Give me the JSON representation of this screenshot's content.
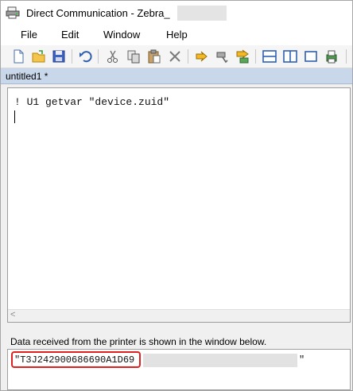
{
  "window": {
    "title": "Direct Communication - Zebra_"
  },
  "menu": {
    "items": [
      "File",
      "Edit",
      "Window",
      "Help"
    ]
  },
  "toolbar": {
    "icons": [
      "new-file-icon",
      "open-folder-icon",
      "save-icon",
      "undo-icon",
      "cut-icon",
      "copy-icon",
      "paste-icon",
      "delete-icon",
      "send-icon",
      "receive-icon",
      "send-file-icon",
      "split-horizontal-icon",
      "split-vertical-icon",
      "single-pane-icon",
      "print-icon"
    ]
  },
  "document": {
    "tab_title": "untitled1 *",
    "code": "! U1 getvar \"device.zuid\""
  },
  "editor": {
    "scroll_left_glyph": "<"
  },
  "output": {
    "status": "Data received from the printer is shown in the window below.",
    "value": "\"T3J242900686690A1D69",
    "end_quote": "\""
  },
  "colors": {
    "highlight": "#e02020",
    "tab_header": "#c9d7ea"
  }
}
